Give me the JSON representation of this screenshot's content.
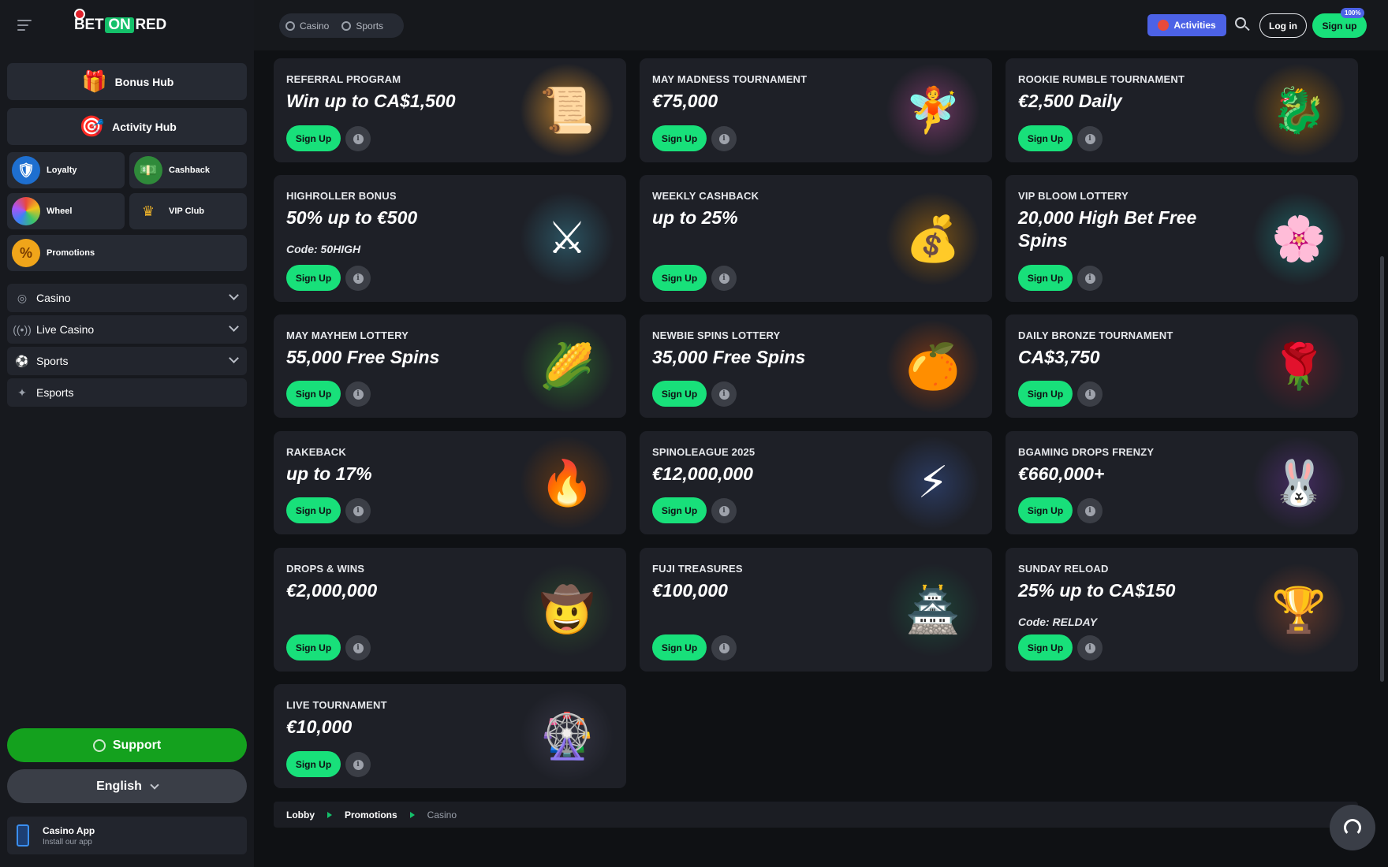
{
  "brand": {
    "logo_pre": "BET",
    "logo_on": "ON",
    "logo_post": "RED"
  },
  "sidebar": {
    "bonus_hub": "Bonus Hub",
    "activity_hub": "Activity Hub",
    "loyalty": "Loyalty",
    "cashback": "Cashback",
    "wheel": "Wheel",
    "vip_club": "VIP Club",
    "promotions": "Promotions",
    "nav": [
      "Casino",
      "Live Casino",
      "Sports",
      "Esports"
    ],
    "support": "Support",
    "language": "English",
    "app_title": "Casino App",
    "app_sub": "Install our app"
  },
  "header": {
    "toggle_casino": "Casino",
    "toggle_sports": "Sports",
    "activities": "Activities",
    "login": "Log in",
    "signup": "Sign up",
    "badge": "100%"
  },
  "cards": [
    {
      "title": "REFERRAL PROGRAM",
      "amount": "Win up to CA$1,500",
      "code": "",
      "button": "Sign Up",
      "icon": "scroll-icon"
    },
    {
      "title": "MAY MADNESS TOURNAMENT",
      "amount": "€75,000",
      "code": "",
      "button": "Sign Up",
      "icon": "fairy-icon"
    },
    {
      "title": "ROOKIE RUMBLE TOURNAMENT",
      "amount": "€2,500 Daily",
      "code": "",
      "button": "Sign Up",
      "icon": "dragon-icon"
    },
    {
      "title": "HIGHROLLER BONUS",
      "amount": "50% up to €500",
      "code": "Code: 50HIGH",
      "button": "Sign Up",
      "icon": "knight-icon"
    },
    {
      "title": "WEEKLY CASHBACK",
      "amount": "up to 25%",
      "code": "",
      "button": "Sign Up",
      "icon": "cashback-chest-icon"
    },
    {
      "title": "VIP BLOOM LOTTERY",
      "amount": "20,000 High Bet Free Spins",
      "code": "",
      "button": "Sign Up",
      "icon": "vip-lady-icon"
    },
    {
      "title": "MAY MAYHEM LOTTERY",
      "amount": "55,000 Free Spins",
      "code": "",
      "button": "Sign Up",
      "icon": "farmer-icon"
    },
    {
      "title": "NEWBIE SPINS LOTTERY",
      "amount": "35,000 Free Spins",
      "code": "",
      "button": "Sign Up",
      "icon": "fruits-icon"
    },
    {
      "title": "DAILY BRONZE TOURNAMENT",
      "amount": "CA$3,750",
      "code": "",
      "button": "Sign Up",
      "icon": "forest-lady-icon"
    },
    {
      "title": "RAKEBACK",
      "amount": "up to 17%",
      "code": "",
      "button": "Sign Up",
      "icon": "rakeback-icon"
    },
    {
      "title": "SPINOLEAGUE 2025",
      "amount": "€12,000,000",
      "code": "",
      "button": "Sign Up",
      "icon": "zeus-icon"
    },
    {
      "title": "BGAMING DROPS FRENZY",
      "amount": "€660,000+",
      "code": "",
      "button": "Sign Up",
      "icon": "rabbit-icon"
    },
    {
      "title": "DROPS & WINS",
      "amount": "€2,000,000",
      "code": "",
      "button": "Sign Up",
      "icon": "adventurer-icon"
    },
    {
      "title": "FUJI TREASURES",
      "amount": "€100,000",
      "code": "",
      "button": "Sign Up",
      "icon": "geisha-icon"
    },
    {
      "title": "SUNDAY RELOAD",
      "amount": "25% up to CA$150",
      "code": "Code: RELDAY",
      "button": "Sign Up",
      "icon": "trophy-icon"
    },
    {
      "title": "LIVE TOURNAMENT",
      "amount": "€10,000",
      "code": "",
      "button": "Sign Up",
      "icon": "roulette-icon"
    }
  ],
  "breadcrumb": [
    "Lobby",
    "Promotions",
    "Casino"
  ],
  "colors": {
    "accent": "#18e07a",
    "support": "#14a11e",
    "activities": "#4c62e6"
  }
}
